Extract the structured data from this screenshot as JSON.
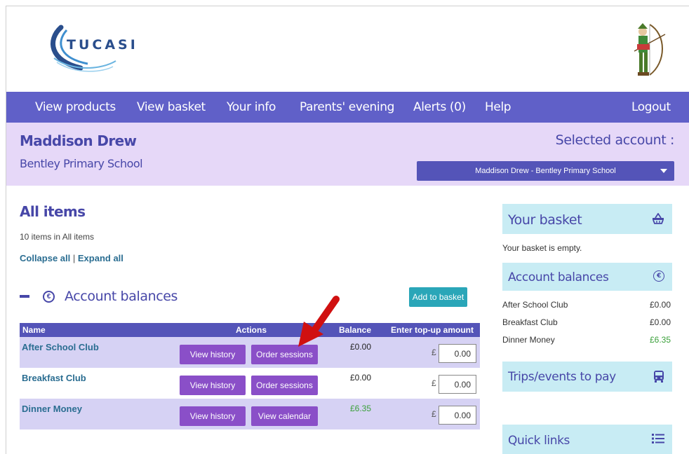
{
  "header": {
    "logo_text": "TUCASI"
  },
  "nav": {
    "items": [
      "View products",
      "View basket",
      "Your info",
      "Parents' evening",
      "Alerts (0)",
      "Help"
    ],
    "logout": "Logout"
  },
  "user": {
    "name": "Maddison Drew",
    "school": "Bentley Primary School",
    "selected_label": "Selected account :",
    "selected_value": "Maddison Drew - Bentley Primary School"
  },
  "main": {
    "title": "All items",
    "count": "10 items in All items",
    "collapse": "Collapse all",
    "separator": "|",
    "expand": "Expand all",
    "section_title": "Account balances",
    "add_to_basket": "Add to basket",
    "columns": {
      "name": "Name",
      "actions": "Actions",
      "balance": "Balance",
      "topup": "Enter top-up amount"
    },
    "rows": [
      {
        "name": "After School Club",
        "btn1": "View history",
        "btn2": "Order sessions",
        "balance": "£0.00",
        "currency": "£",
        "amount": "0.00"
      },
      {
        "name": "Breakfast Club",
        "btn1": "View history",
        "btn2": "Order sessions",
        "balance": "£0.00",
        "currency": "£",
        "amount": "0.00"
      },
      {
        "name": "Dinner Money",
        "btn1": "View history",
        "btn2": "View calendar",
        "balance": "£6.35",
        "currency": "£",
        "amount": "0.00"
      }
    ]
  },
  "sidebar": {
    "basket_title": "Your basket",
    "basket_empty": "Your basket is empty.",
    "balances_title": "Account balances",
    "balances": [
      {
        "label": "After School Club",
        "value": "£0.00"
      },
      {
        "label": "Breakfast Club",
        "value": "£0.00"
      },
      {
        "label": "Dinner Money",
        "value": "£6.35"
      }
    ],
    "trips_title": "Trips/events to pay",
    "quicklinks_title": "Quick links"
  },
  "colors": {
    "nav_bg": "#6060c8",
    "userbar_bg": "#e6d8f8",
    "button_purple": "#8a4fc8",
    "teal_button": "#2aa6b8",
    "sidebar_panel": "#c8ecf4",
    "positive_balance": "#3aa03a",
    "annotation_arrow": "#d01010"
  }
}
